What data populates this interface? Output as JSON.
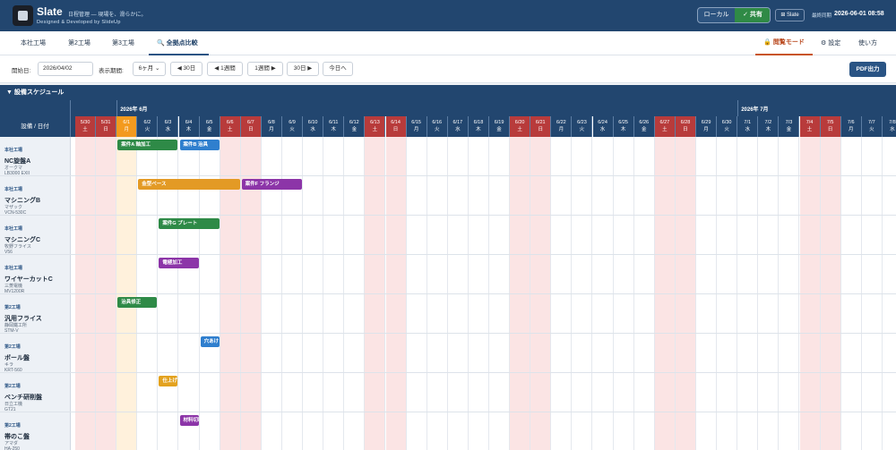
{
  "header": {
    "app_name": "Slate",
    "tagline": "日程管理 — 現場を、滑らかに。",
    "byline": "Designed & Developed by SlideUp",
    "mode_local": "ローカル",
    "mode_shared": "✓ 共有",
    "slate_badge": "⊞ Slate",
    "sync_label": "最終同期",
    "sync_time": "2026-06-01 08:58"
  },
  "tabs": [
    {
      "label": "本社工場"
    },
    {
      "label": "第2工場"
    },
    {
      "label": "第3工場"
    },
    {
      "label": "🔍 全拠点比較"
    }
  ],
  "tab_right": {
    "view_mode": "🔒 閲覧モード",
    "settings": "⚙ 設定",
    "help": "使い方"
  },
  "toolbar": {
    "start_label": "開始日:",
    "start_value": "2026/04/02",
    "period_label": "表示期間:",
    "period_value": "6ヶ月 ⌄",
    "back30": "◀ 30日",
    "back1w": "◀ 1週間",
    "fwd1w": "1週間 ▶",
    "fwd30": "30日 ▶",
    "today": "今日へ",
    "pdf": "PDF出力"
  },
  "schedule": {
    "section_title": "▼ 設備スケジュール",
    "corner_label": "設備 / 日付",
    "months": [
      "2026年 6月",
      "2026年 7月"
    ],
    "days": [
      {
        "d": "5/30",
        "w": "土",
        "t": "holiday"
      },
      {
        "d": "5/31",
        "w": "日",
        "t": "holiday"
      },
      {
        "d": "6/1",
        "w": "月",
        "t": "today"
      },
      {
        "d": "6/2",
        "w": "火",
        "t": "normal"
      },
      {
        "d": "6/3",
        "w": "水",
        "t": "normal"
      },
      {
        "d": "6/4",
        "w": "木",
        "t": "normal"
      },
      {
        "d": "6/5",
        "w": "金",
        "t": "normal"
      },
      {
        "d": "6/6",
        "w": "土",
        "t": "holiday"
      },
      {
        "d": "6/7",
        "w": "日",
        "t": "holiday"
      },
      {
        "d": "6/8",
        "w": "月",
        "t": "normal"
      },
      {
        "d": "6/9",
        "w": "火",
        "t": "normal"
      },
      {
        "d": "6/10",
        "w": "水",
        "t": "normal"
      },
      {
        "d": "6/11",
        "w": "木",
        "t": "normal"
      },
      {
        "d": "6/12",
        "w": "金",
        "t": "normal"
      },
      {
        "d": "6/13",
        "w": "土",
        "t": "holiday"
      },
      {
        "d": "6/14",
        "w": "日",
        "t": "holiday"
      },
      {
        "d": "6/15",
        "w": "月",
        "t": "normal"
      },
      {
        "d": "6/16",
        "w": "火",
        "t": "normal"
      },
      {
        "d": "6/17",
        "w": "水",
        "t": "normal"
      },
      {
        "d": "6/18",
        "w": "木",
        "t": "normal"
      },
      {
        "d": "6/19",
        "w": "金",
        "t": "normal"
      },
      {
        "d": "6/20",
        "w": "土",
        "t": "holiday"
      },
      {
        "d": "6/21",
        "w": "日",
        "t": "holiday"
      },
      {
        "d": "6/22",
        "w": "月",
        "t": "normal"
      },
      {
        "d": "6/23",
        "w": "火",
        "t": "normal"
      },
      {
        "d": "6/24",
        "w": "水",
        "t": "normal"
      },
      {
        "d": "6/25",
        "w": "木",
        "t": "normal"
      },
      {
        "d": "6/26",
        "w": "金",
        "t": "normal"
      },
      {
        "d": "6/27",
        "w": "土",
        "t": "holiday"
      },
      {
        "d": "6/28",
        "w": "日",
        "t": "holiday"
      },
      {
        "d": "6/29",
        "w": "月",
        "t": "normal"
      },
      {
        "d": "6/30",
        "w": "火",
        "t": "normal"
      },
      {
        "d": "7/1",
        "w": "水",
        "t": "normal"
      },
      {
        "d": "7/2",
        "w": "木",
        "t": "normal"
      },
      {
        "d": "7/3",
        "w": "金",
        "t": "normal"
      },
      {
        "d": "7/4",
        "w": "土",
        "t": "holiday"
      },
      {
        "d": "7/5",
        "w": "日",
        "t": "holiday"
      },
      {
        "d": "7/6",
        "w": "月",
        "t": "normal"
      },
      {
        "d": "7/7",
        "w": "火",
        "t": "normal"
      },
      {
        "d": "7/8",
        "w": "水",
        "t": "normal"
      }
    ],
    "machines": [
      {
        "plant": "本社工場",
        "name": "NC旋盤A",
        "details": [
          "オークマ",
          "LB3000 EXII",
          "φ400×1000"
        ]
      },
      {
        "plant": "本社工場",
        "name": "マシニングB",
        "details": [
          "マザック",
          "VCN-530C",
          "テーブル1300×560"
        ]
      },
      {
        "plant": "本社工場",
        "name": "マシニングC",
        "details": [
          "牧野フライス",
          "V56",
          "テーブル600×500"
        ]
      },
      {
        "plant": "本社工場",
        "name": "ワイヤーカットC",
        "details": [
          "三菱電機",
          "MV1200R",
          "板厚 最大295"
        ]
      },
      {
        "plant": "第2工場",
        "name": "汎用フライス",
        "details": [
          "静岡鐵工所",
          "STM-V",
          "テーブル1150×260"
        ]
      },
      {
        "plant": "第2工場",
        "name": "ボール盤",
        "details": [
          "キラ",
          "KRT-560",
          "最大φ32"
        ]
      },
      {
        "plant": "第2工場",
        "name": "ベンチ研削盤",
        "details": [
          "日立工機",
          "GT21",
          "砥石φ205"
        ]
      },
      {
        "plant": "第2工場",
        "name": "帯のこ盤",
        "details": [
          "アマダ",
          "HA-250",
          "切断φ250"
        ]
      }
    ],
    "tasks": [
      {
        "row": 0,
        "start": 2,
        "span": 3,
        "label": "案件A 軸加工",
        "color": "#2e8a47"
      },
      {
        "row": 0,
        "start": 5,
        "span": 2,
        "label": "案件B 治具",
        "color": "#2f7fce"
      },
      {
        "row": 1,
        "start": 3,
        "span": 5,
        "label": "金型ベース",
        "color": "#e39a25"
      },
      {
        "row": 1,
        "start": 8,
        "span": 3,
        "label": "案件F フランジ",
        "color": "#8c35a8"
      },
      {
        "row": 2,
        "start": 4,
        "span": 3,
        "label": "案件G プレート",
        "color": "#2e8a47"
      },
      {
        "row": 3,
        "start": 4,
        "span": 2,
        "label": "電極加工",
        "color": "#8c35a8"
      },
      {
        "row": 4,
        "start": 2,
        "span": 2,
        "label": "治具修正",
        "color": "#2e8a47"
      },
      {
        "row": 5,
        "start": 6,
        "span": 1,
        "label": "穴あけ",
        "color": "#2f7fce"
      },
      {
        "row": 6,
        "start": 4,
        "span": 1,
        "label": "仕上げ",
        "color": "#e3a21f"
      },
      {
        "row": 7,
        "start": 5,
        "span": 1,
        "label": "材料切断",
        "color": "#8c35a8"
      }
    ],
    "colors": {
      "header_bg": "#22466f",
      "holiday_head": "#b83b3b",
      "holiday_col": "#fbe4e4",
      "today_head": "#f39a1e",
      "today_col": "#fff1dc"
    }
  }
}
